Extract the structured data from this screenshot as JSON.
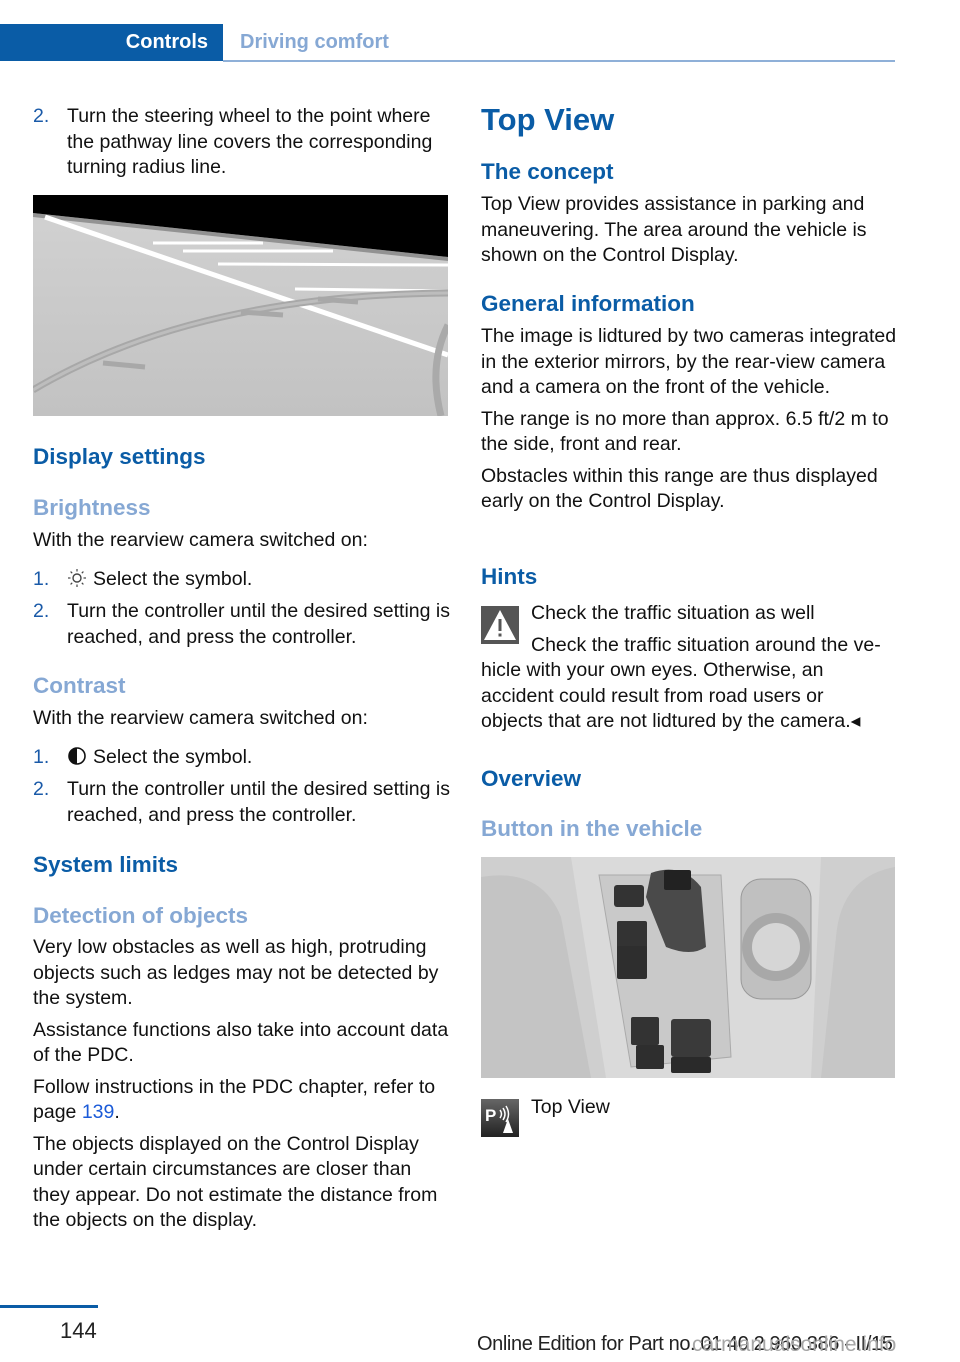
{
  "header": {
    "chapter_tab": "Controls",
    "section_tab": "Driving comfort"
  },
  "left": {
    "step2_num": "2.",
    "step2_text": "Turn the steering wheel to the point where the pathway line covers the corresponding turning radius line.",
    "display_settings_heading": "Display settings",
    "brightness_heading": "Brightness",
    "brightness_intro": "With the rearview camera switched on:",
    "brightness_steps": [
      {
        "num": "1.",
        "icon": "brightness-sun-icon",
        "text": "Select the symbol."
      },
      {
        "num": "2.",
        "text": "Turn the controller until the desired setting is reached, and press the controller."
      }
    ],
    "contrast_heading": "Contrast",
    "contrast_intro": "With the rearview camera switched on:",
    "contrast_steps": [
      {
        "num": "1.",
        "icon": "contrast-half-circle-icon",
        "text": "Select the symbol."
      },
      {
        "num": "2.",
        "text": "Turn the controller until the desired setting is reached, and press the controller."
      }
    ],
    "system_limits_heading": "System limits",
    "detection_heading": "Detection of objects",
    "detection_p1": "Very low obstacles as well as high, protruding objects such as ledges may not be detected by the system.",
    "detection_p2": "Assistance functions also take into account data of the PDC.",
    "detection_p3_pre": "Follow instructions in the PDC chapter, refer to page ",
    "detection_p3_link": "139",
    "detection_p3_post": ".",
    "detection_p4": "The objects displayed on the Control Display under certain circumstances are closer than they appear. Do not estimate the distance from the objects on the display."
  },
  "right": {
    "top_view_heading": "Top View",
    "concept_heading": "The concept",
    "concept_text": "Top View provides assistance in parking and maneuvering. The area around the vehicle is shown on the Control Display.",
    "general_heading": "General information",
    "general_p1": "The image is lidtured by two cameras integrated in the exterior mirrors, by the rear-view camera and a camera on the front of the vehicle.",
    "general_p2": "The range is no more than approx. 6.5 ft/2 m to the side, front and rear.",
    "general_p3": "Obstacles within this range are thus displayed early on the Control Display.",
    "hints_heading": "Hints",
    "warning_title": "Check the traffic situation as well",
    "warning_line1": "Check the traffic situation around the ve-",
    "warning_rest": "hicle with your own eyes. Otherwise, an accident could result from road users or objects that are not lidtured by the camera.◂",
    "overview_heading": "Overview",
    "button_heading": "Button in the vehicle",
    "button_label": "Top View",
    "button_icon_letter": "P"
  },
  "footer": {
    "page_number": "144",
    "edition_text": "Online Edition for Part no. 01 40 2 960 386 - II/15",
    "watermark": "carmanualsonline.info"
  },
  "colors": {
    "accent_blue": "#0a5ca6",
    "light_blue_heading": "#86a8d4",
    "link_blue": "#1a5ad8"
  }
}
